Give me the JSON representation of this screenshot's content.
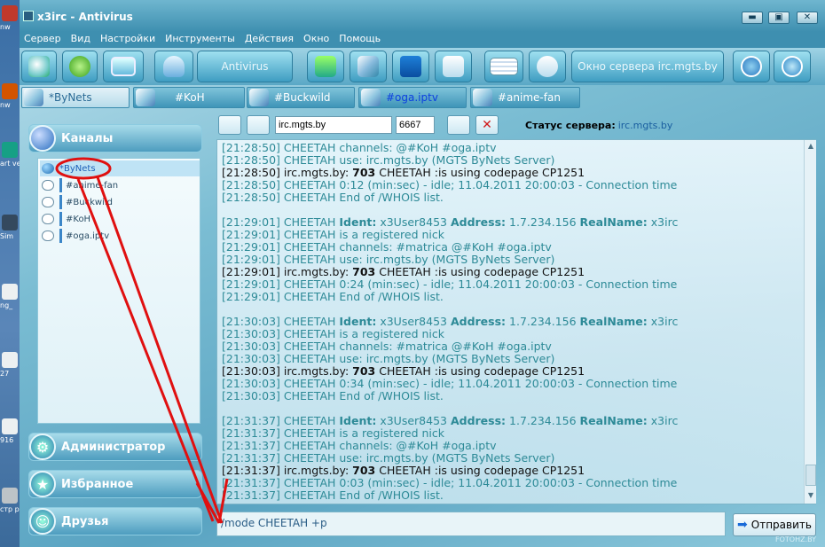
{
  "desktop": {
    "icons": [
      "nw",
      "nw",
      "art\nver",
      "Sim",
      "ng_",
      "27",
      "916",
      "стр\nрак"
    ]
  },
  "window": {
    "title": "x3irc - Antivirus",
    "buttons": [
      "▬",
      "▣",
      "✕"
    ]
  },
  "menu": [
    "Сервер",
    "Вид",
    "Настройки",
    "Инструменты",
    "Действия",
    "Окно",
    "Помощь"
  ],
  "toolbar": {
    "antivirus_label": "Antivirus",
    "server_window_label": "Окно сервера irc.mgts.by",
    "icons": [
      "connect-icon",
      "tools-icon",
      "monitor-icon",
      "user-icon",
      "download-icon",
      "edit-icon",
      "music-icon",
      "copy-icon",
      "screen-icon",
      "chat-icon",
      "info-icon",
      "power-icon"
    ]
  },
  "tabs": [
    {
      "label": "*ByNets",
      "active": true
    },
    {
      "label": "#KoH"
    },
    {
      "label": "#Buckwild"
    },
    {
      "label": "#oga.iptv",
      "highlight": true
    },
    {
      "label": "#anime-fan"
    }
  ],
  "left": {
    "channels_header": "Каналы",
    "channels": [
      "*ByNets",
      "#anime-fan",
      "#Buckwild",
      "#KoH",
      "#oga.iptv"
    ],
    "admin": "Администратор",
    "favorites": "Избранное",
    "friends": "Друзья"
  },
  "server_bar": {
    "host": "irc.mgts.by",
    "port": "6667",
    "status_label": "Статус сервера:",
    "status_value": "irc.mgts.by"
  },
  "log": [
    {
      "parts": [
        {
          "t": "[21:28:50] CHEETAH channels: @#KoH #oga.iptv"
        }
      ]
    },
    {
      "parts": [
        {
          "t": "[21:28:50] CHEETAH use: irc.mgts.by (MGTS ByNets Server)"
        }
      ]
    },
    {
      "dark": true,
      "parts": [
        {
          "t": "[21:28:50] irc.mgts.by: "
        },
        {
          "t": "703",
          "b": true
        },
        {
          "t": " CHEETAH :is using codepage CP1251"
        }
      ]
    },
    {
      "parts": [
        {
          "t": "[21:28:50] CHEETAH 0:12 (min:sec) -  idle; 11.04.2011 20:00:03 - Connection time"
        }
      ]
    },
    {
      "parts": [
        {
          "t": "[21:28:50] CHEETAH End of /WHOIS list."
        }
      ]
    },
    {
      "blank": true
    },
    {
      "parts": [
        {
          "t": "[21:29:01] CHEETAH "
        },
        {
          "t": "Ident:",
          "b": true
        },
        {
          "t": " x3User8453 "
        },
        {
          "t": "Address:",
          "b": true
        },
        {
          "t": " 1.7.234.156 "
        },
        {
          "t": "RealName:",
          "b": true
        },
        {
          "t": " x3irc"
        }
      ]
    },
    {
      "parts": [
        {
          "t": "[21:29:01] CHEETAH is a registered nick"
        }
      ]
    },
    {
      "parts": [
        {
          "t": "[21:29:01] CHEETAH channels: #matrica @#KoH #oga.iptv"
        }
      ]
    },
    {
      "parts": [
        {
          "t": "[21:29:01] CHEETAH use: irc.mgts.by (MGTS ByNets Server)"
        }
      ]
    },
    {
      "dark": true,
      "parts": [
        {
          "t": "[21:29:01] irc.mgts.by: "
        },
        {
          "t": "703",
          "b": true
        },
        {
          "t": " CHEETAH :is using codepage CP1251"
        }
      ]
    },
    {
      "parts": [
        {
          "t": "[21:29:01] CHEETAH 0:24 (min:sec) -  idle; 11.04.2011 20:00:03 - Connection time"
        }
      ]
    },
    {
      "parts": [
        {
          "t": "[21:29:01] CHEETAH End of /WHOIS list."
        }
      ]
    },
    {
      "blank": true
    },
    {
      "parts": [
        {
          "t": "[21:30:03] CHEETAH "
        },
        {
          "t": "Ident:",
          "b": true
        },
        {
          "t": " x3User8453 "
        },
        {
          "t": "Address:",
          "b": true
        },
        {
          "t": " 1.7.234.156 "
        },
        {
          "t": "RealName:",
          "b": true
        },
        {
          "t": " x3irc"
        }
      ]
    },
    {
      "parts": [
        {
          "t": "[21:30:03] CHEETAH is a registered nick"
        }
      ]
    },
    {
      "parts": [
        {
          "t": "[21:30:03] CHEETAH channels: #matrica @#KoH #oga.iptv"
        }
      ]
    },
    {
      "parts": [
        {
          "t": "[21:30:03] CHEETAH use: irc.mgts.by (MGTS ByNets Server)"
        }
      ]
    },
    {
      "dark": true,
      "parts": [
        {
          "t": "[21:30:03] irc.mgts.by: "
        },
        {
          "t": "703",
          "b": true
        },
        {
          "t": " CHEETAH :is using codepage CP1251"
        }
      ]
    },
    {
      "parts": [
        {
          "t": "[21:30:03] CHEETAH 0:34 (min:sec) -  idle; 11.04.2011 20:00:03 - Connection time"
        }
      ]
    },
    {
      "parts": [
        {
          "t": "[21:30:03] CHEETAH End of /WHOIS list."
        }
      ]
    },
    {
      "blank": true
    },
    {
      "parts": [
        {
          "t": "[21:31:37] CHEETAH "
        },
        {
          "t": "Ident:",
          "b": true
        },
        {
          "t": " x3User8453 "
        },
        {
          "t": "Address:",
          "b": true
        },
        {
          "t": " 1.7.234.156 "
        },
        {
          "t": "RealName:",
          "b": true
        },
        {
          "t": " x3irc"
        }
      ]
    },
    {
      "parts": [
        {
          "t": "[21:31:37] CHEETAH is a registered nick"
        }
      ]
    },
    {
      "parts": [
        {
          "t": "[21:31:37] CHEETAH channels: @#KoH #oga.iptv"
        }
      ]
    },
    {
      "parts": [
        {
          "t": "[21:31:37] CHEETAH use: irc.mgts.by (MGTS ByNets Server)"
        }
      ]
    },
    {
      "dark": true,
      "parts": [
        {
          "t": "[21:31:37] irc.mgts.by: "
        },
        {
          "t": "703",
          "b": true
        },
        {
          "t": " CHEETAH :is using codepage CP1251"
        }
      ]
    },
    {
      "parts": [
        {
          "t": "[21:31:37] CHEETAH 0:03 (min:sec) -  idle; 11.04.2011 20:00:03 - Connection time"
        }
      ]
    },
    {
      "parts": [
        {
          "t": "[21:31:37] CHEETAH End of /WHOIS list."
        }
      ]
    }
  ],
  "input": {
    "value": "/mode CHEETAH +p"
  },
  "send_label": "Отправить",
  "watermark": "FOTOHZ.BY",
  "colors": {
    "log_text": "#2d8a97",
    "annotation": "#e01010"
  }
}
